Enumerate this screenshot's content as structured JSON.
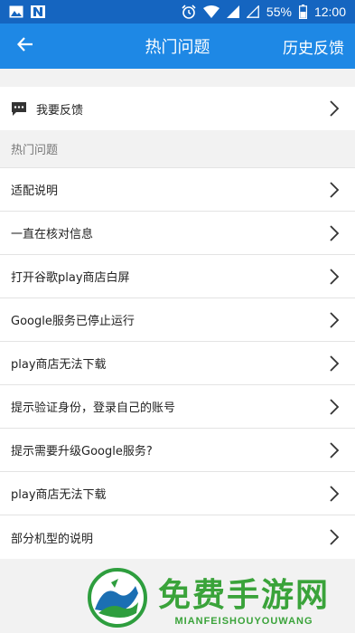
{
  "status_bar": {
    "battery": "55%",
    "time": "12:00",
    "icons": [
      "image-icon",
      "n-icon",
      "alarm-icon",
      "wifi-icon",
      "signal-icon",
      "signal-empty-icon",
      "battery-icon"
    ]
  },
  "app_bar": {
    "title": "热门问题",
    "history_label": "历史反馈",
    "back_icon": "back-arrow-icon"
  },
  "feedback_row": {
    "label": "我要反馈",
    "icon": "chat-bubble-icon"
  },
  "section": {
    "title": "热门问题"
  },
  "questions": [
    {
      "label": "适配说明"
    },
    {
      "label": "一直在核对信息"
    },
    {
      "label": "打开谷歌play商店白屏"
    },
    {
      "label": "Google服务已停止运行"
    },
    {
      "label": "play商店无法下载"
    },
    {
      "label": "提示验证身份，登录自己的账号"
    },
    {
      "label": "提示需要升级Google服务?"
    },
    {
      "label": "play商店无法下载"
    },
    {
      "label": "部分机型的说明"
    }
  ],
  "watermark": {
    "main": "免费手游网",
    "sub": "MIANFEISHOUYOUWANG"
  },
  "colors": {
    "status_bar": "#1565c0",
    "app_bar": "#1e88e5",
    "watermark": "#3aa33a"
  }
}
